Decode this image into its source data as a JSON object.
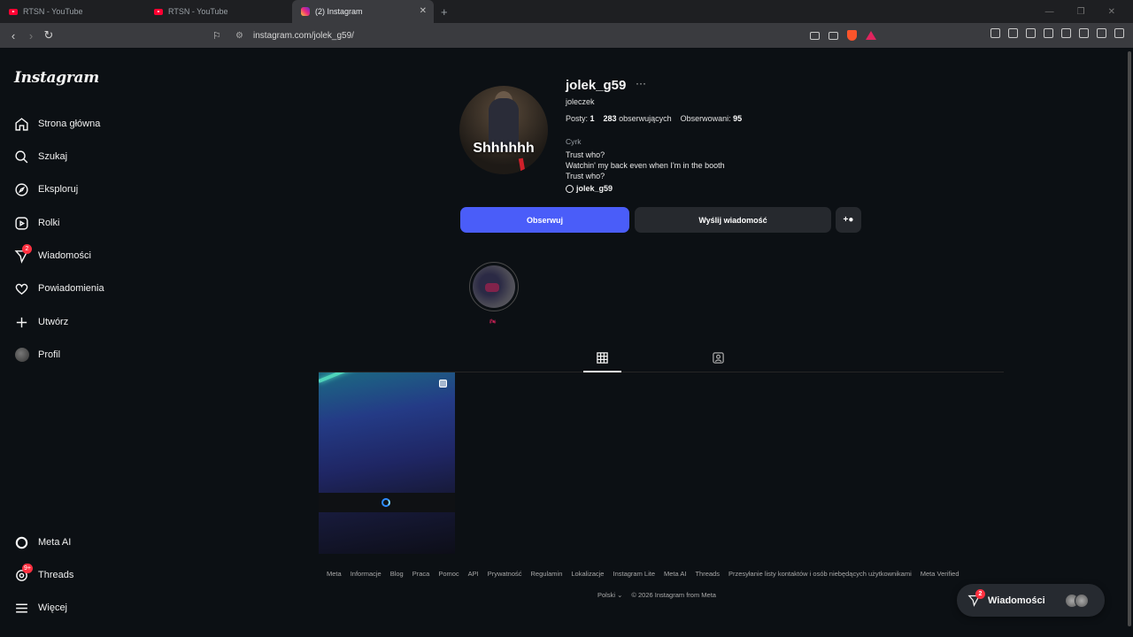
{
  "browser": {
    "tabs": [
      {
        "label": "RTSN - YouTube",
        "active": false
      },
      {
        "label": "RTSN - YouTube",
        "active": false
      },
      {
        "label": "(2) Instagram",
        "active": true
      }
    ],
    "url": "instagram.com/jolek_g59/"
  },
  "sidebar": {
    "logo": "Instagram",
    "items": [
      {
        "label": "Strona główna",
        "icon": "home-icon"
      },
      {
        "label": "Szukaj",
        "icon": "search-icon"
      },
      {
        "label": "Eksploruj",
        "icon": "compass-icon"
      },
      {
        "label": "Rolki",
        "icon": "reels-icon"
      },
      {
        "label": "Wiadomości",
        "icon": "messenger-icon",
        "badge": "2"
      },
      {
        "label": "Powiadomienia",
        "icon": "heart-icon"
      },
      {
        "label": "Utwórz",
        "icon": "plus-icon"
      },
      {
        "label": "Profil",
        "icon": "avatar"
      },
      {
        "label": "Meta AI",
        "icon": "meta-ai-icon"
      },
      {
        "label": "Threads",
        "icon": "threads-icon",
        "badge": "9+"
      },
      {
        "label": "Więcej",
        "icon": "menu-icon"
      }
    ]
  },
  "profile": {
    "username": "jolek_g59",
    "full_name": "joleczek",
    "picture_text": "Shhhhhh",
    "stats": {
      "posts_label": "Posty:",
      "posts": "1",
      "followers": "283",
      "followers_label": "obserwujących",
      "following_label": "Obserwowani:",
      "following": "95"
    },
    "category": "Cyrk",
    "bio": [
      "Trust who?",
      "Watchin' my back even when I'm in the booth",
      "Trust who?"
    ],
    "threads_handle": "jolek_g59",
    "buttons": {
      "follow": "Obserwuj",
      "message": "Wyślij wiadomość"
    },
    "highlight_label": "🏍"
  },
  "footer": {
    "links": [
      "Meta",
      "Informacje",
      "Blog",
      "Praca",
      "Pomoc",
      "API",
      "Prywatność",
      "Regulamin",
      "Lokalizacje",
      "Instagram Lite",
      "Meta AI",
      "Threads",
      "Przesyłanie listy kontaktów i osób niebędących użytkownikami",
      "Meta Verified"
    ],
    "language": "Polski",
    "copyright": "© 2026 Instagram from Meta"
  },
  "messages_pill": {
    "label": "Wiadomości",
    "badge": "2"
  },
  "colors": {
    "follow_button": "#4a5df9",
    "badge": "#ff3040",
    "background": "#0c1014"
  }
}
